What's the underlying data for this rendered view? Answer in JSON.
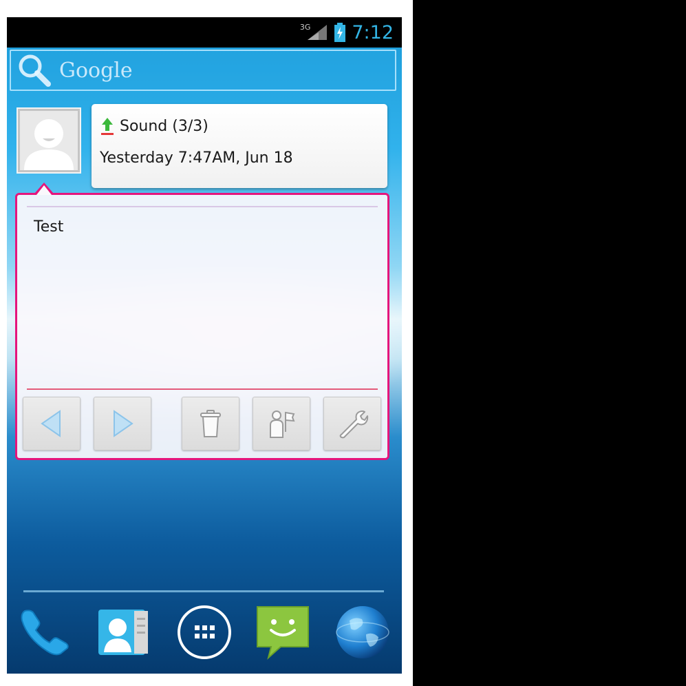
{
  "status_bar": {
    "network": "3G",
    "time": "7:12"
  },
  "search": {
    "brand": "Google"
  },
  "notification": {
    "title": "Sound (3/3)",
    "timestamp": "Yesterday 7:47AM, Jun 18",
    "message": "Test"
  },
  "actions": [
    {
      "icon": "previous-icon"
    },
    {
      "icon": "next-icon"
    },
    {
      "icon": "trash-icon"
    },
    {
      "icon": "contact-flag-icon"
    },
    {
      "icon": "wrench-icon"
    }
  ],
  "dock": [
    {
      "icon": "phone-icon"
    },
    {
      "icon": "contacts-icon"
    },
    {
      "icon": "app-drawer-icon"
    },
    {
      "icon": "messaging-icon"
    },
    {
      "icon": "browser-globe-icon"
    }
  ],
  "colors": {
    "accent": "#33b5e5",
    "card_border": "#e5157c"
  }
}
